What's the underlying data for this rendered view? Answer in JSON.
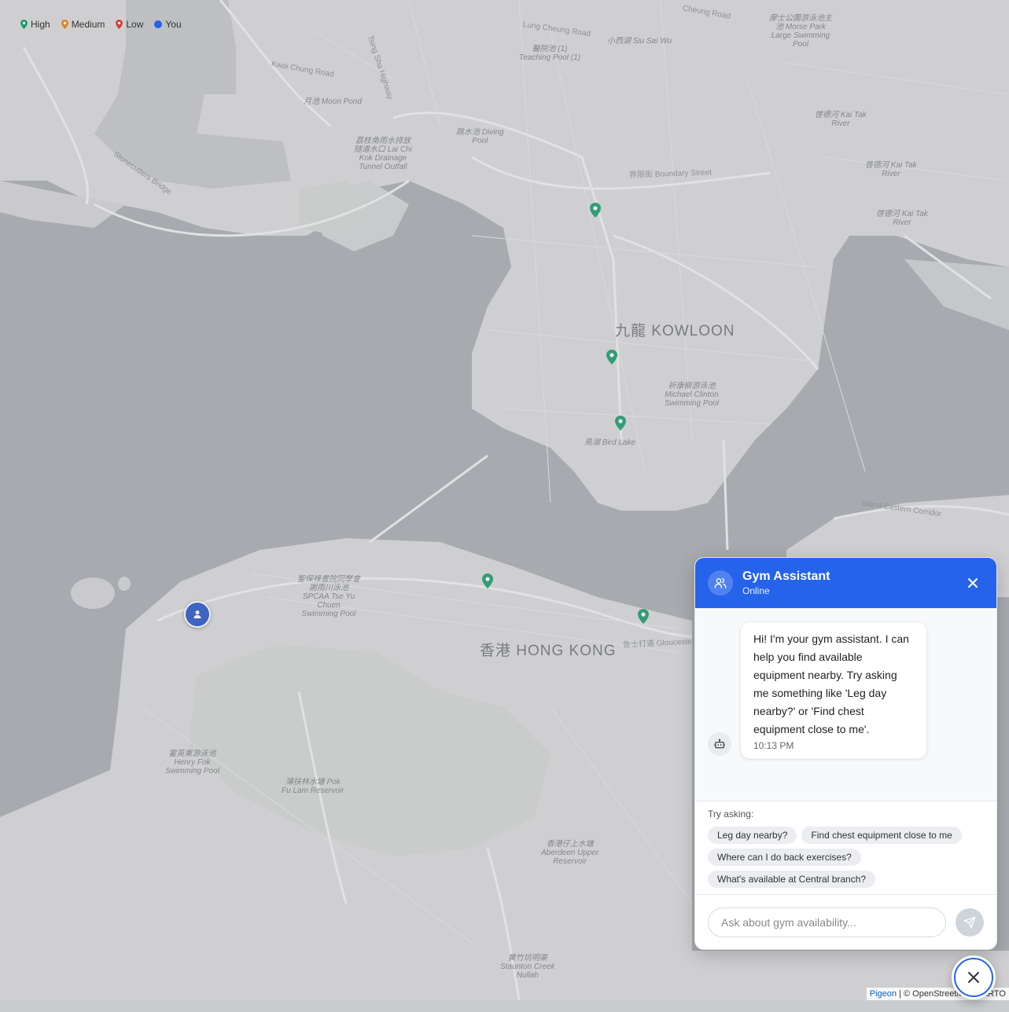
{
  "legend": {
    "items": [
      {
        "label": "High",
        "color": "#1a9b6c"
      },
      {
        "label": "Medium",
        "color": "#e0812a"
      },
      {
        "label": "Low",
        "color": "#d63b3b"
      },
      {
        "label": "You",
        "color": "#2563eb"
      }
    ]
  },
  "map": {
    "districts": {
      "kowloon": "九龍 KOWLOON",
      "hong_kong": "香港 HONG KONG"
    },
    "labels": {
      "lung_cheung": "Lung Cheung Road",
      "cheung_road": "Cheung Road",
      "teaching_pool_zh": "醫院池 (1)",
      "teaching_pool": "Teaching Pool (1)",
      "siu_sai_wu": "小西湖 Siu Sai Wu",
      "morse_park_zh": "摩士公園游泳池主",
      "morse_park": "池 Morse Park",
      "morse_park2": "Large Swimming",
      "morse_park3": "Pool",
      "kwai_chung": "Kwai Chung Road",
      "moon_pond": "月池 Moon Pond",
      "tsing_sha": "Tsing Sha Highway",
      "diving_pool_zh": "跳水池 Diving",
      "diving_pool": "Pool",
      "kai_tak_river_zh1": "啓德河 Kai Tak",
      "kai_tak_river1": "River",
      "kai_tak_river_zh2": "啓德河 Kai Tak",
      "kai_tak_river2": "River",
      "kai_tak_river_zh3": "啓德河 Kai Tak",
      "kai_tak_river3": "River",
      "lai_chi_kok_zh": "荔枝角雨水排放",
      "lai_chi_kok_zh2": "隧道水口 Lai Chi",
      "lai_chi_kok": "Kok Drainage",
      "lai_chi_kok2": "Tunnel Outfall",
      "boundary": "界限街 Boundary Street",
      "stonecutters": "Stonecutters Bridge",
      "michael_clinton_zh": "祈康柳游泳池",
      "michael_clinton": "Michael Clinton",
      "michael_clinton2": "Swimming Pool",
      "bird_lake": "鳥湖 Bird Lake",
      "island_eastern": "Island Eastern Corridor",
      "spcaa_zh1": "聖保祿書院同學會",
      "spcaa_zh2": "謝雨川泳池",
      "spcaa1": "SPCAA Tse Yu",
      "spcaa2": "Chuen",
      "spcaa3": "Swimming Pool",
      "henry_fok_zh": "霍英東游泳池",
      "henry_fok": "Henry Fok",
      "henry_fok2": "Swimming Pool",
      "pok_fu_lam_zh": "薄扶林水塘 Pok",
      "pok_fu_lam": "Fu Lam Reservoir",
      "aberdeen_zh": "香港仔上水塘",
      "aberdeen": "Aberdeen Upper",
      "aberdeen2": "Reservoir",
      "stounton_zh": "黄竹坑明渠",
      "stounton": "Staunton Creek",
      "stounton2": "Nullah",
      "gloucester": "告士打道 Glouceste"
    }
  },
  "attribution": {
    "link": "Pigeon",
    "text": " | © OpenStreetMap CARTO"
  },
  "chat": {
    "title": "Gym Assistant",
    "status": "Online",
    "message": {
      "text": "Hi! I'm your gym assistant. I can help you find available equipment nearby. Try asking me something like 'Leg day nearby?' or 'Find chest equipment close to me'.",
      "time": "10:13 PM"
    },
    "suggestions_title": "Try asking:",
    "suggestions": [
      "Leg day nearby?",
      "Find chest equipment close to me",
      "Where can I do back exercises?",
      "What's available at Central branch?"
    ],
    "input_placeholder": "Ask about gym availability..."
  }
}
